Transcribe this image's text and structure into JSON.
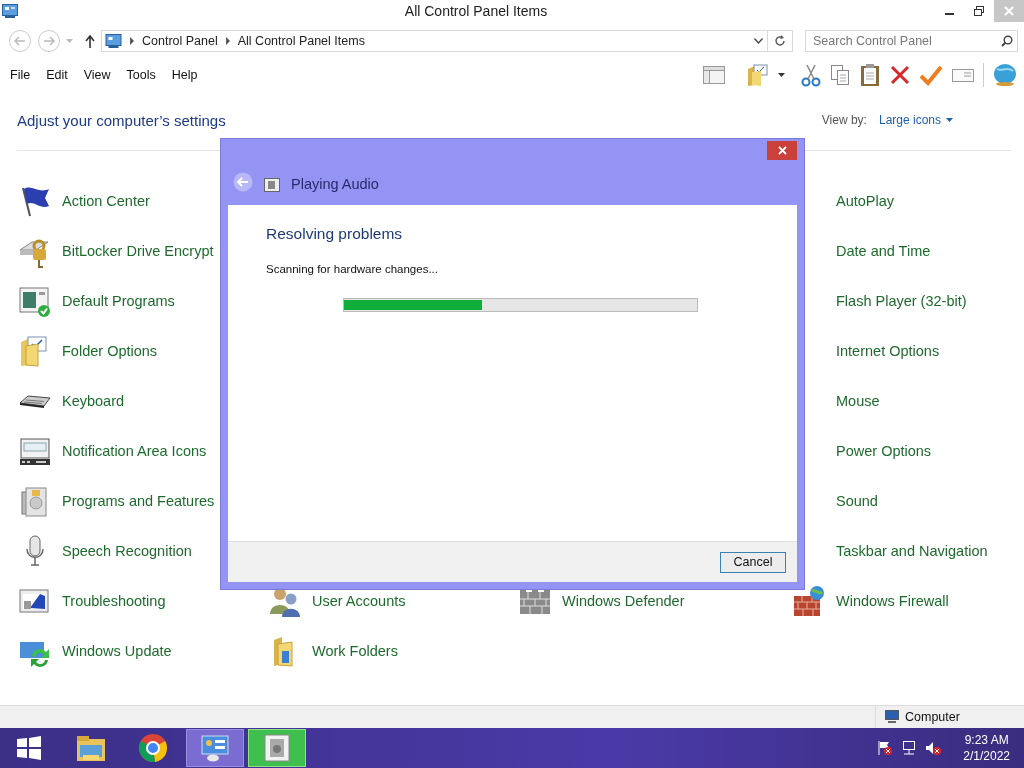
{
  "window": {
    "title": "All Control Panel Items"
  },
  "address_bar": {
    "crumbs": [
      "Control Panel",
      "All Control Panel Items"
    ]
  },
  "search": {
    "placeholder": "Search Control Panel"
  },
  "menu": [
    "File",
    "Edit",
    "View",
    "Tools",
    "Help"
  ],
  "header": {
    "title": "Adjust your computer’s settings",
    "view_by_label": "View by:",
    "view_by_value": "Large icons"
  },
  "rows": [
    {
      "col_1": {
        "label": "Action Center",
        "kind": "icon"
      },
      "col_4": {
        "label": "AutoPlay",
        "kind": "label"
      }
    },
    {
      "col_1": {
        "label": "BitLocker Drive Encrypt",
        "kind": "icon"
      },
      "col_4": {
        "label": "Date and Time",
        "kind": "label"
      }
    },
    {
      "col_1": {
        "label": "Default Programs",
        "kind": "icon"
      },
      "col_4": {
        "label": "Flash Player (32-bit)",
        "kind": "label"
      }
    },
    {
      "col_1": {
        "label": "Folder Options",
        "kind": "icon"
      },
      "col_4": {
        "label": "Internet Options",
        "kind": "label"
      }
    },
    {
      "col_1": {
        "label": "Keyboard",
        "kind": "icon"
      },
      "col_4": {
        "label": "Mouse",
        "kind": "label"
      }
    },
    {
      "col_1": {
        "label": "Notification Area Icons",
        "kind": "icon"
      },
      "col_4": {
        "label": "Power Options",
        "kind": "label"
      }
    },
    {
      "col_1": {
        "label": "Programs and Features",
        "kind": "icon"
      },
      "col_4": {
        "label": "Sound",
        "kind": "label"
      }
    },
    {
      "col_1": {
        "label": "Speech Recognition",
        "kind": "icon"
      },
      "col_4": {
        "label": "Taskbar and Navigation",
        "kind": "label"
      }
    },
    {
      "col_1": {
        "label": "Troubleshooting",
        "kind": "icon"
      },
      "col_2": {
        "label": "User Accounts",
        "kind": "icon"
      },
      "col_3": {
        "label": "Windows Defender",
        "kind": "icon"
      },
      "col_4": {
        "label": "Windows Firewall",
        "kind": "icon"
      }
    },
    {
      "col_1": {
        "label": "Windows Update",
        "kind": "icon"
      },
      "col_2": {
        "label": "Work Folders",
        "kind": "icon"
      }
    }
  ],
  "dialog": {
    "title": "Playing Audio",
    "heading": "Resolving problems",
    "status": "Scanning for hardware changes...",
    "progress": {
      "level": 0.39
    },
    "buttons": [
      "Cancel"
    ]
  },
  "status_bar": {
    "location": "Computer"
  },
  "taskbar": {
    "apps": [
      {
        "open": false,
        "active": false
      },
      {
        "open": false,
        "active": false
      },
      {
        "open": true,
        "active": false
      },
      {
        "open": true,
        "active": true
      }
    ]
  },
  "clock": {
    "time": "9:23 AM",
    "date": "2/1/2022"
  }
}
